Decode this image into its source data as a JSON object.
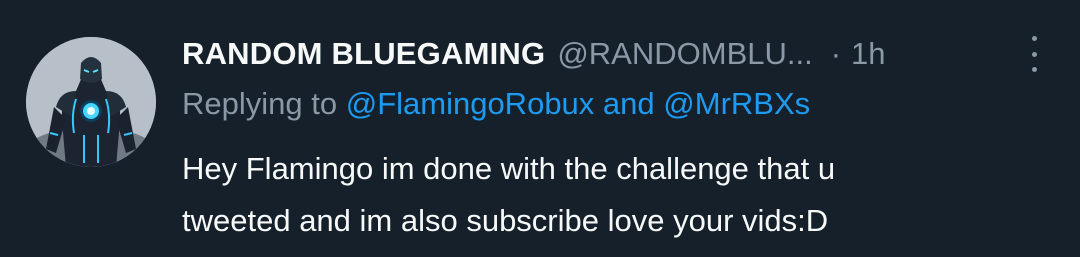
{
  "tweet": {
    "display_name": "RANDOM BLUEGAMING",
    "handle": "@RANDOMBLU...",
    "separator": "·",
    "time": "1h",
    "reply_prefix": "Replying to",
    "reply_mention_1": "@FlamingoRobux",
    "reply_and": "and",
    "reply_mention_2": "@MrRBXs",
    "body_line_1": "Hey Flamingo im done with the challenge that u",
    "body_line_2": "tweeted and im also subscribe love your vids:D"
  },
  "icons": {
    "more": "more-vertical-icon",
    "avatar": "avatar-armored-figure"
  },
  "colors": {
    "background": "#15202b",
    "primary_text": "#f7f9f9",
    "secondary_text": "#8b98a5",
    "mention": "#1d9bf0"
  }
}
